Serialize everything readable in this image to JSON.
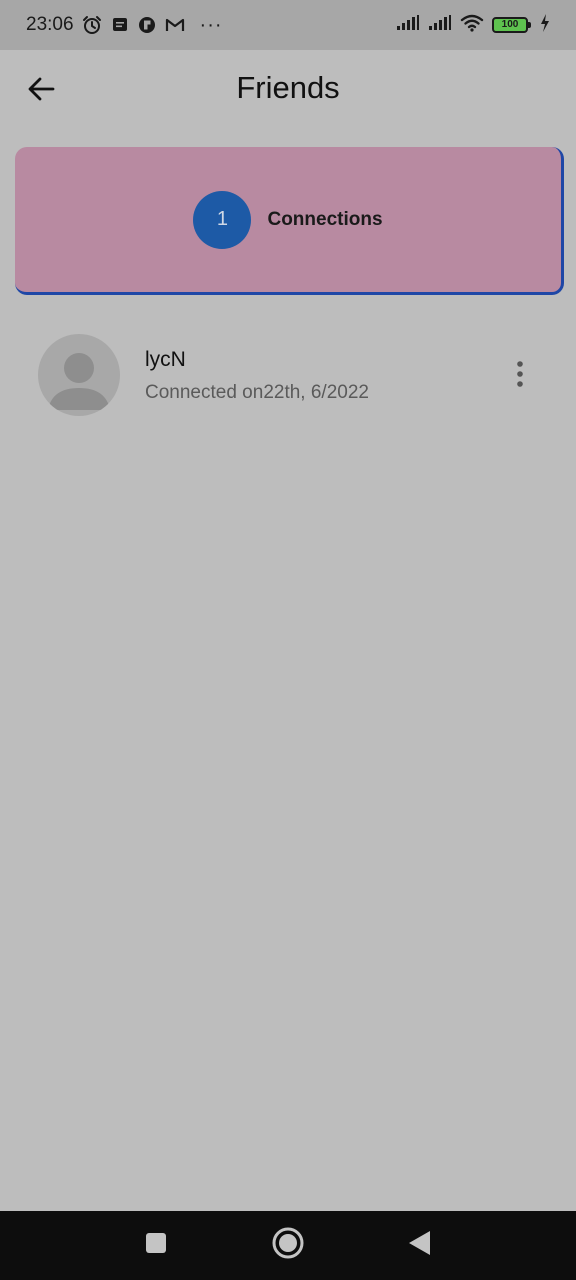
{
  "status_bar": {
    "time": "23:06",
    "left_icons": [
      "alarm-icon",
      "message-icon",
      "app-icon",
      "gmail-icon"
    ],
    "more": "···",
    "right_icons": [
      "signal-icon",
      "signal-icon",
      "wifi-icon",
      "battery-icon",
      "charging-icon"
    ],
    "battery_level": "100",
    "colors": {
      "battery_fill": "#5ec24f"
    }
  },
  "app_bar": {
    "back_icon": "arrow-left-icon",
    "title": "Friends"
  },
  "connections_card": {
    "count": "1",
    "label": "Connections",
    "colors": {
      "card": "#b88aa1",
      "circle": "#1d5aa6",
      "border": "#1f47a6"
    }
  },
  "friends": [
    {
      "name": "lycN",
      "subtitle": "Connected on22th, 6/2022",
      "avatar_icon": "default-avatar-icon",
      "menu_icon": "more-vertical-icon"
    }
  ],
  "nav_bar": {
    "buttons": [
      "recents-icon",
      "home-icon",
      "back-triangle-icon"
    ]
  }
}
